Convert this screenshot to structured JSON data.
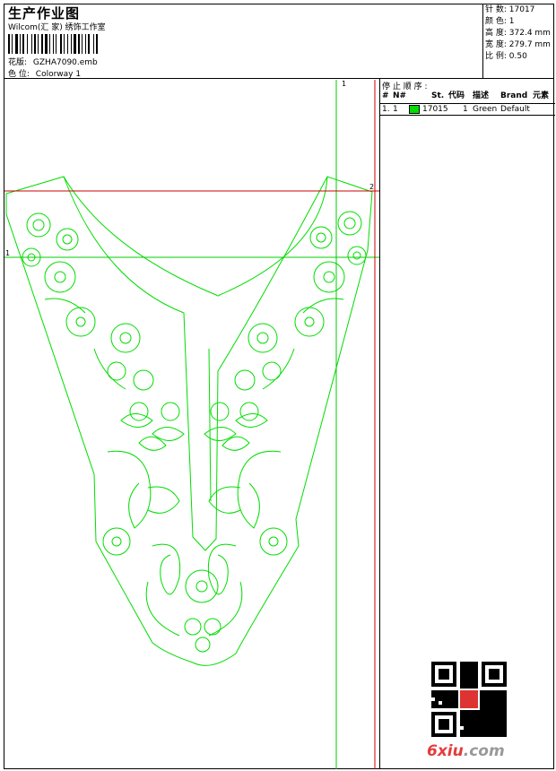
{
  "header": {
    "title": "生产作业图",
    "company": "Wilcom(汇 家) 绣饰工作室",
    "design_label": "花版:",
    "design_value": "GZHA7090.emb",
    "colorway_label": "色 位:",
    "colorway_value": "Colorway 1"
  },
  "stats": {
    "stitches_label": "针 数:",
    "stitches_value": "17017",
    "colors_label": "颜 色:",
    "colors_value": "1",
    "height_label": "高 度:",
    "height_value": "372.4 mm",
    "width_label": "宽 度:",
    "width_value": "279.7 mm",
    "scale_label": "比 例:",
    "scale_value": "0.50"
  },
  "sequence": {
    "title": "停 止 顺 序 :",
    "headers": {
      "num": "#",
      "no": "N#",
      "st": "St.",
      "code": "代码",
      "desc": "描述",
      "brand": "Brand",
      "element": "元素"
    },
    "rows": [
      {
        "num": "1.",
        "no": "1",
        "code": "17015",
        "st": "1",
        "desc": "Green",
        "brand": "Default",
        "color": "#00dd00"
      }
    ]
  },
  "guides": {
    "vertical_label": "1",
    "horizontal_label_1": "1",
    "horizontal_label_2": "2"
  },
  "watermark": {
    "brand": "6xiu",
    "dot": ".",
    "domain": "com"
  },
  "colors": {
    "thread": "#00dd00",
    "guide_green": "#00cc00",
    "guide_red": "#cc0000"
  }
}
